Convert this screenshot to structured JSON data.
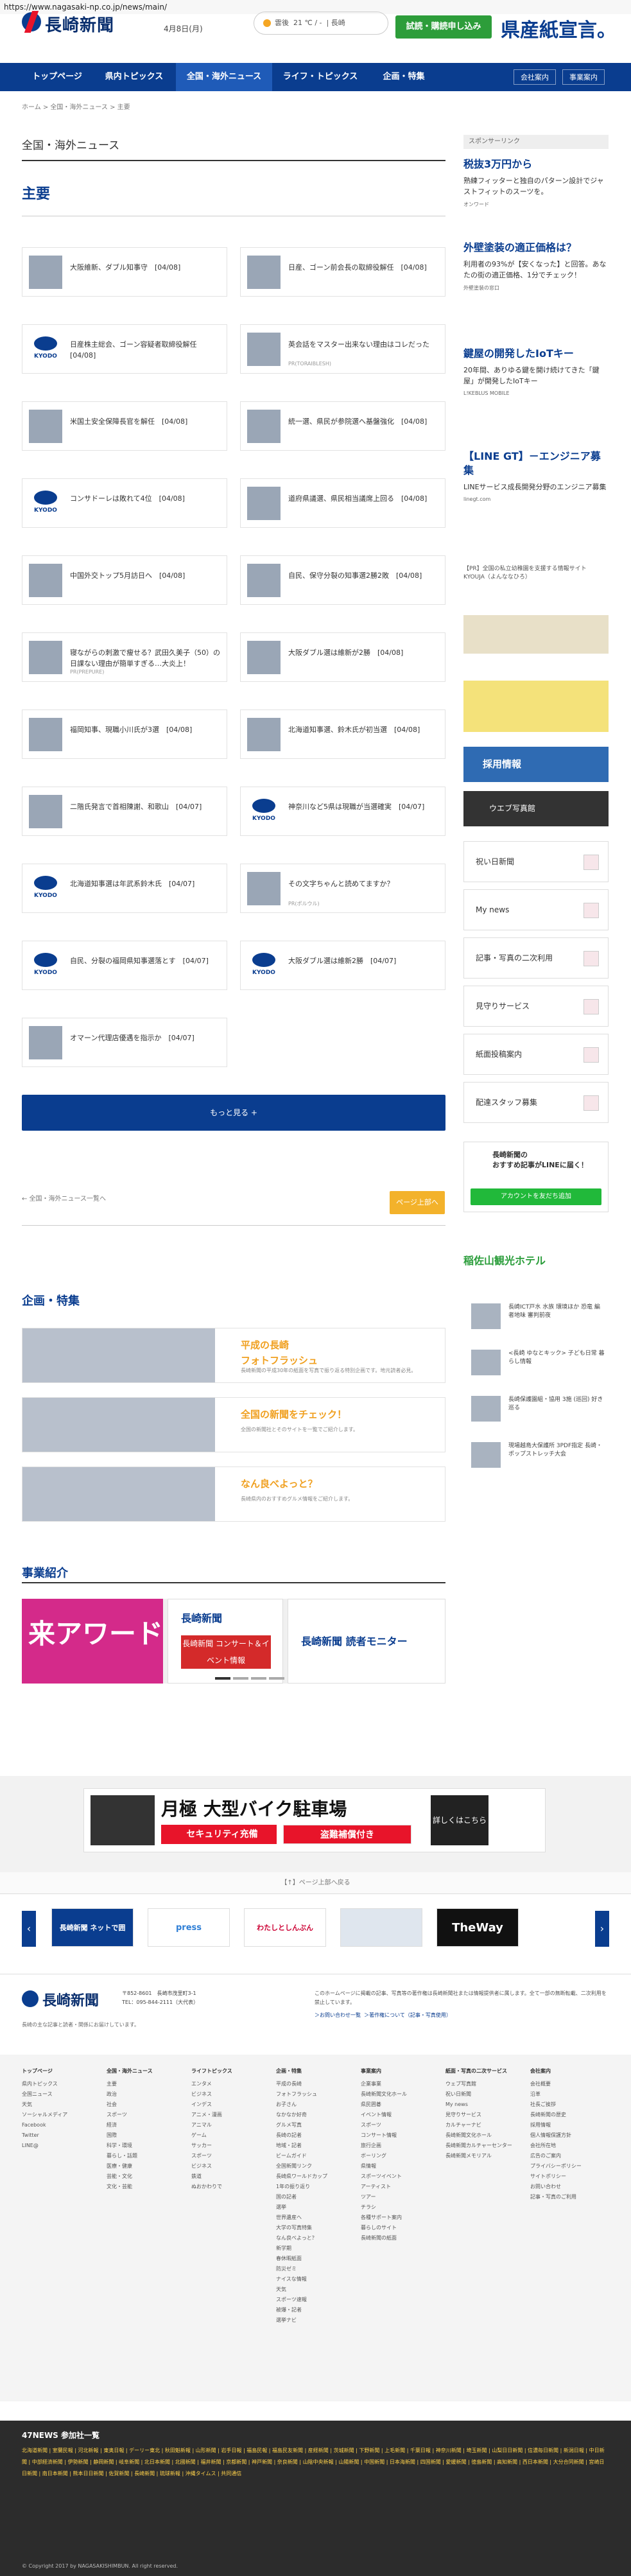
{
  "url": "https://www.nagasaki-np.co.jp/news/main/",
  "header": {
    "logo": "長崎新聞",
    "date": "4月8日(月)",
    "weather_label": "雲後",
    "weather_temp": "21 ℃ / -",
    "weather_link": "長崎",
    "trial_button": "試読・購読申し込み",
    "slogan": "県産紙宣言。"
  },
  "nav": {
    "items": [
      "トップページ",
      "県内トピックス",
      "全国・海外ニュース",
      "ライフ・トピックス",
      "企画・特集"
    ],
    "right": [
      "会社案内",
      "事業案内"
    ]
  },
  "breadcrumb": "ホーム > 全国・海外ニュース > 主要",
  "section_title": "全国・海外ニュース",
  "main_heading": "主要",
  "articles": [
    {
      "title": "大阪維新、ダブル知事守　[04/08]",
      "sub": "",
      "kyodo": false
    },
    {
      "title": "日産、ゴーン前会長の取締役解任　[04/08]",
      "sub": "",
      "kyodo": false
    },
    {
      "title": "日産株主総会、ゴーン容疑者取締役解任　[04/08]",
      "sub": "",
      "kyodo": true
    },
    {
      "title": "英会話をマスター出来ない理由はコレだった",
      "sub": "PR(TORAIBLESH)",
      "kyodo": false
    },
    {
      "title": "米国土安全保障長官を解任　[04/08]",
      "sub": "",
      "kyodo": false
    },
    {
      "title": "統一選、県民が参院選へ基盤強化　[04/08]",
      "sub": "",
      "kyodo": false
    },
    {
      "title": "コンサドーレは敗れて4位　[04/08]",
      "sub": "",
      "kyodo": true
    },
    {
      "title": "道府県議選、県民相当議席上回る　[04/08]",
      "sub": "",
      "kyodo": false
    },
    {
      "title": "中国外交トップ5月訪日へ　[04/08]",
      "sub": "",
      "kyodo": false
    },
    {
      "title": "自民、保守分裂の知事選2勝2敗　[04/08]",
      "sub": "",
      "kyodo": false
    },
    {
      "title": "寝ながらの刺激で瘦せる？武田久美子（50）の日課ない理由が簡単すぎる…大炎上！",
      "sub": "PR(PREPURE)",
      "kyodo": false
    },
    {
      "title": "大阪ダブル選は維新が2勝　[04/08]",
      "sub": "",
      "kyodo": false
    },
    {
      "title": "福岡知事、現職小川氏が3選　[04/08]",
      "sub": "",
      "kyodo": false
    },
    {
      "title": "北海道知事選、鈴木氏が初当選　[04/08]",
      "sub": "",
      "kyodo": false
    },
    {
      "title": "二階氏発言で首相陳謝、和歌山　[04/07]",
      "sub": "",
      "kyodo": false
    },
    {
      "title": "神奈川など5県は現職が当選確実　[04/07]",
      "sub": "",
      "kyodo": true
    },
    {
      "title": "北海道知事選は年武系鈴木氏　[04/07]",
      "sub": "",
      "kyodo": true
    },
    {
      "title": "その文字ちゃんと読めてますか？",
      "sub": "PR(ポルウル)",
      "kyodo": false
    },
    {
      "title": "自民、分裂の福岡県知事選落とす　[04/07]",
      "sub": "",
      "kyodo": true
    },
    {
      "title": "大阪ダブル選は維新2勝　[04/07]",
      "sub": "",
      "kyodo": true
    },
    {
      "title": "オマーン代理店優遇を指示か　[04/07]",
      "sub": "",
      "kyodo": false
    }
  ],
  "more_button": "もっと見る +",
  "back_to_list": "← 全国・海外ニュース一覧へ",
  "to_top": "ページ上部へ",
  "features_heading": "企画・特集",
  "features": [
    {
      "title": "平成の長崎\nフォトフラッシュ",
      "desc": "長崎新聞の平成30年の紙面を写真で振り返る特別企画です。地元読者必見。"
    },
    {
      "title": "全国の新聞をチェック！",
      "desc": "全国の新聞社とそのサイトを一覧でご紹介します。"
    },
    {
      "title": "なん良べよっと？",
      "desc": "長崎県内のおすすめグルメ情報をご紹介します。"
    }
  ],
  "jigyo_heading": "事業紹介",
  "jigyo_banners": [
    "来アワード",
    "長崎新聞 コンサート＆イベント情報",
    "長崎新聞 読者モニター"
  ],
  "sidebar": {
    "sponsor_label": "スポンサーリンク",
    "ads": [
      {
        "head": "税抜3万円から",
        "body": "熟練フィッターと独自のパターン設計でジャストフィットのスーツを。",
        "source": "オンワード"
      },
      {
        "head": "外壁塗装の適正価格は？",
        "body": "利用者の93%が【安くなった】と回答。あなたの街の適正価格、1分でチェック！",
        "source": "外壁塗装の窓口"
      },
      {
        "head": "鍵屋の開発したIoTキー",
        "body": "20年間、ありゆる鍵を開け続けてきた「鍵屋」が開発したIoTキー",
        "source": "L!KEBLUS MOBILE"
      },
      {
        "head": "【LINE GT】－エンジニア募集",
        "body": "LINEサービス成長開発分野のエンジニア募集",
        "source": "linegt.com"
      }
    ],
    "pr_note": "【PR】全国の私立幼稚園を支援する情報サイト KYOUJA（よんななひろ）",
    "recruit": "採用情報",
    "food": "ウエブ写真館",
    "buttons": [
      "祝い日新聞",
      "My news",
      "記事・写真の二次利用",
      "見守りサービス",
      "紙面投稿案内",
      "配達スタッフ募集"
    ],
    "line_text": "長崎新聞の\nおすすめ記事がLINEに届く！",
    "line_button": "アカウントを友だち追加",
    "hotel": "稲佐山観光ホテル",
    "news": [
      "長崎ICT戸水 水族 環境ほか 恐竜 編者地味 審判前夜",
      "<長崎 ゆなとキック> 子ども日常 暮らし情報",
      "長崎保護園組・協用 3施 (巡回) 好き巡る",
      "現場越島大保護所 3PDF指定 長崎・ポップストレッチ大会"
    ]
  },
  "bottom_ad": {
    "title": "月極 大型バイク駐車場",
    "tag1": "セキュリティ充備",
    "tag2": "盗難補償付き",
    "side": "詳しくはこちら"
  },
  "ad_label": "【↑】ページ上部へ戻る",
  "partner_banners": [
    "長崎新聞 ネットで囲",
    "press",
    "わたしとしんぶん",
    "",
    "TheWay"
  ],
  "footer": {
    "logo": "長崎新聞",
    "address": "〒852-8601　長崎市茂里町3-1\nTEL：095-844-2111（大代表）",
    "note": "長崎の主な記事と読者・関係にお届けしています。",
    "copyright_text": "このホームページに掲載の記事、写真等の著作権は長崎新聞社または情報提供者に属します。全て一部の無断転載、二次利用を禁止しています。",
    "links": [
      "＞お問い合わせ一覧",
      "＞著作権について（記事・写真使用）"
    ],
    "cols": [
      {
        "head": "トップページ",
        "items": [
          "県内トピックス",
          "全国ニュース",
          "天気",
          "ソーシャルメディア",
          "Facebook",
          "Twitter",
          "LINE@"
        ]
      },
      {
        "head": "全国・海外ニュース",
        "items": [
          "主要",
          "政治",
          "社会",
          "スポーツ",
          "経済",
          "国際",
          "科学・環境",
          "暮らし・話題",
          "医療・健康",
          "芸能・文化",
          "文化・芸能"
        ]
      },
      {
        "head": "ライフトピックス",
        "items": [
          "エンタメ",
          "ビジネス",
          "インデス",
          "アニメ・漫画",
          "アニマル",
          "ゲーム",
          "サッカー",
          "スポーツ",
          "ビジネス",
          "鉄道",
          "ぬおかわりで"
        ]
      },
      {
        "head": "企画・特集",
        "items": [
          "平成の長崎",
          "フォトフラッシュ",
          "お子さん",
          "なかなか好奇",
          "グルメ写真",
          "長崎の記者",
          "地域・記者",
          "ビームガイド",
          "全国新聞リンク",
          "長崎県ワールドカップ",
          "1年の振り返り",
          "国の記者",
          "選挙",
          "世界遺産へ",
          "大学の写真特集",
          "なん良べよっと？",
          "新学期",
          "春休暇紙面",
          "防災ゼミ",
          "ナイスな情報",
          "天気",
          "スポーツ速報",
          "被爆・記者",
          "選挙ナビ"
        ]
      },
      {
        "head": "事業案内",
        "items": [
          "企業事業",
          "長崎新聞文化ホール",
          "県民囲碁",
          "イベント情報",
          "スポーツ",
          "コンサート情報",
          "旅行企画",
          "ボーリング",
          "県情報",
          "スポーツイベント",
          "アーティスト",
          "ツアー",
          "チラシ",
          "各種サポート案内",
          "暮らしのサイト",
          "長崎新聞の紙面"
        ]
      },
      {
        "head": "紙面・写真の二次サービス",
        "items": [
          "ウェブ写真館",
          "祝い日新聞",
          "My news",
          "見守りサービス",
          "カルチャーナビ",
          "長崎新聞文化ホール",
          "長崎新聞カルチャーセンター",
          "長崎新聞メモリアル"
        ]
      },
      {
        "head": "会社案内",
        "items": [
          "会社概要",
          "沿革",
          "社長ご挨拶",
          "長崎新聞の歴史",
          "採用情報",
          "個人情報保護方針",
          "会社所在地",
          "広告のご案内",
          "プライバシーポリシー",
          "サイトポリシー",
          "お問い合わせ",
          "記事・写真のご利用"
        ]
      }
    ],
    "partner_heading": "47NEWS 参加社一覧",
    "partners": "北海道新聞 | 室蘭民報 | 河北新報 | 東奥日報 | デーリー東北 | 秋田魁新報 | 山形新聞 | 岩手日報 | 福島民報 | 福島民友新聞 | 産経新聞 | 茨城新聞 | 下野新聞 | 上毛新聞 | 千葉日報 | 神奈川新聞 | 埼玉新聞 | 山梨日日新聞 | 信濃毎日新聞 | 新潟日報 | 中日新聞 | 中部経済新聞 | 伊勢新聞 | 静岡新聞 | 岐阜新聞 | 北日本新聞 | 北國新聞 | 福井新聞 | 京都新聞 | 神戸新聞 | 奈良新聞 | 山陰中央新報 | 山陽新聞 | 中国新聞 | 日本海新聞 | 四国新聞 | 愛媛新聞 | 徳島新聞 | 高知新聞 | 西日本新聞 | 大分合同新聞 | 宮崎日日新聞 | 南日本新聞 | 熊本日日新聞 | 佐賀新聞 | 長崎新聞 | 琉球新報 | 沖縄タイムス | 共同通信",
    "copyright": "© Copyright 2017 by NAGASAKISHIMBUN. All right reserved."
  }
}
